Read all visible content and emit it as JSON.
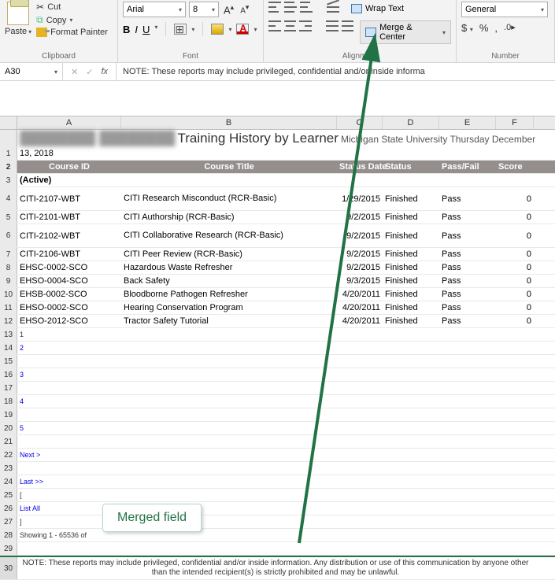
{
  "ribbon": {
    "clipboard": {
      "paste": "Paste",
      "cut": "Cut",
      "copy": "Copy",
      "format_painter": "Format Painter",
      "group": "Clipboard"
    },
    "font": {
      "name": "Arial",
      "size": "8",
      "bold": "B",
      "italic": "I",
      "underline": "U",
      "group": "Font"
    },
    "alignment": {
      "wrap": "Wrap Text",
      "merge": "Merge & Center",
      "group": "Alignment"
    },
    "number": {
      "format": "General",
      "group": "Number"
    }
  },
  "formula_bar": {
    "cell_ref": "A30",
    "value": "NOTE: These reports may include privileged, confidential and/or inside informa"
  },
  "columns": [
    "A",
    "B",
    "C",
    "D",
    "E",
    "F"
  ],
  "title": {
    "name_blur": "████████ ████████",
    "main": "Training History by Learner",
    "sub": "Michigan State University Thursday December",
    "date": "13, 2018"
  },
  "headers": {
    "course_id": "Course ID",
    "course_title": "Course Title",
    "status_date": "Status Date",
    "status": "Status",
    "passfail": "Pass/Fail",
    "score": "Score"
  },
  "section": "(Active)",
  "rows": [
    {
      "rn": "4",
      "id": "CITI-2107-WBT",
      "title": "CITI Research Misconduct (RCR-Basic)",
      "date": "1/29/2015",
      "status": "Finished",
      "pf": "Pass",
      "score": "0",
      "wrap": true
    },
    {
      "rn": "5",
      "id": "CITI-2101-WBT",
      "title": "CITI Authorship (RCR-Basic)",
      "date": "9/2/2015",
      "status": "Finished",
      "pf": "Pass",
      "score": "0"
    },
    {
      "rn": "6",
      "id": "CITI-2102-WBT",
      "title": "CITI Collaborative Research (RCR-Basic)",
      "date": "9/2/2015",
      "status": "Finished",
      "pf": "Pass",
      "score": "0",
      "wrap": true
    },
    {
      "rn": "7",
      "id": "CITI-2106-WBT",
      "title": "CITI Peer Review (RCR-Basic)",
      "date": "9/2/2015",
      "status": "Finished",
      "pf": "Pass",
      "score": "0"
    },
    {
      "rn": "8",
      "id": "EHSC-0002-SCO",
      "title": "Hazardous Waste Refresher",
      "date": "9/2/2015",
      "status": "Finished",
      "pf": "Pass",
      "score": "0"
    },
    {
      "rn": "9",
      "id": "EHSO-0004-SCO",
      "title": "Back Safety",
      "date": "9/3/2015",
      "status": "Finished",
      "pf": "Pass",
      "score": "0"
    },
    {
      "rn": "10",
      "id": "EHSB-0002-SCO",
      "title": "Bloodborne Pathogen Refresher",
      "date": "4/20/2011",
      "status": "Finished",
      "pf": "Pass",
      "score": "0"
    },
    {
      "rn": "11",
      "id": "EHSO-0002-SCO",
      "title": "Hearing Conservation Program",
      "date": "4/20/2011",
      "status": "Finished",
      "pf": "Pass",
      "score": "0"
    },
    {
      "rn": "12",
      "id": "EHSO-2012-SCO",
      "title": "Tractor Safety Tutorial",
      "date": "4/20/2011",
      "status": "Finished",
      "pf": "Pass",
      "score": "0"
    }
  ],
  "pager": {
    "p1": "1",
    "p2": "2",
    "p3": "3",
    "p4": "4",
    "p5": "5",
    "next": "Next >",
    "last": "Last >>",
    "lb": "[",
    "rb": "]",
    "list_all": "List All",
    "showing": "Showing 1 - 65536 of"
  },
  "note": "NOTE: These reports may include privileged, confidential and/or inside information. Any distribution or use of this communication by anyone other than the intended recipient(s) is strictly prohibited and may be unlawful.",
  "annotation": "Merged field"
}
